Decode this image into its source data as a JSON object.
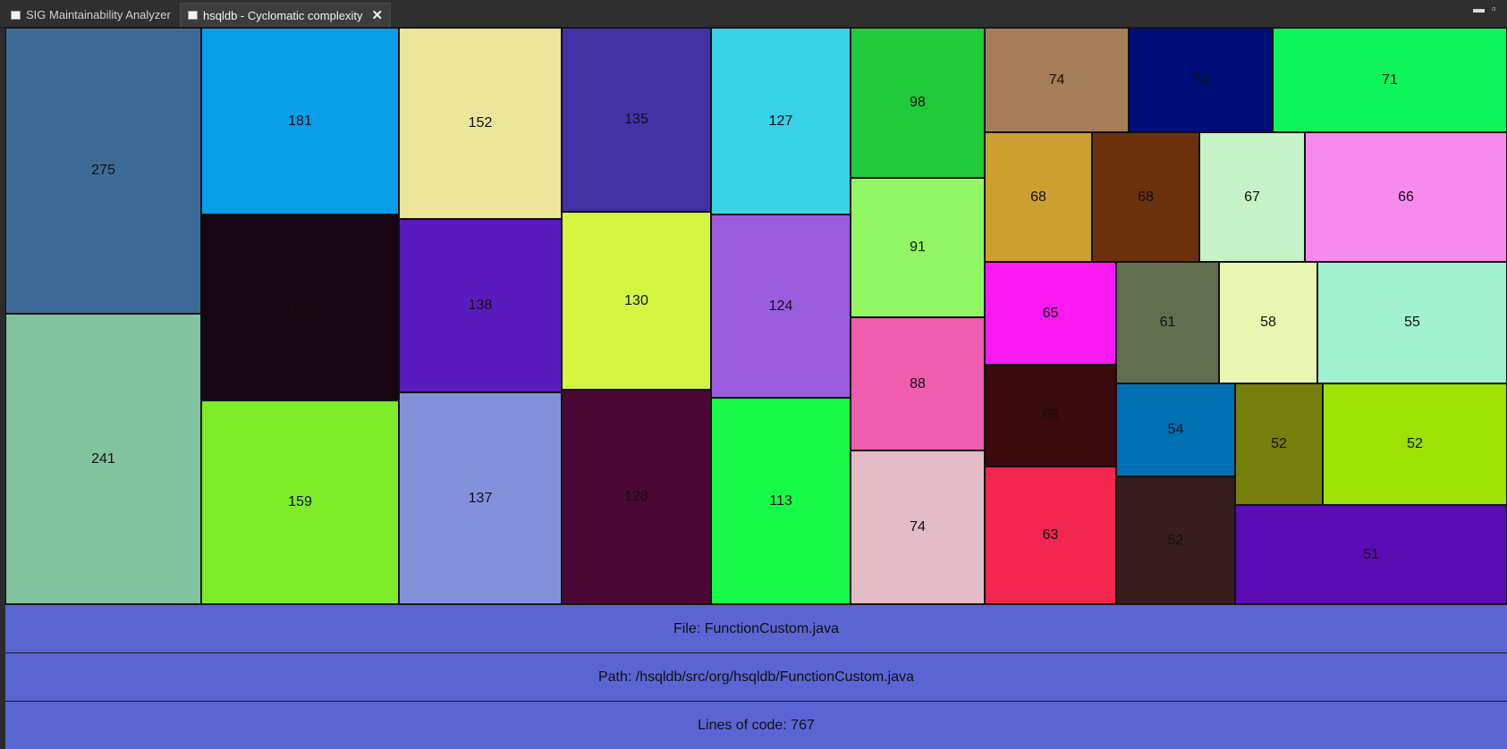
{
  "tabs": [
    {
      "label": "SIG Maintainability Analyzer",
      "active": false
    },
    {
      "label": "hsqldb - Cyclomatic complexity",
      "active": true
    }
  ],
  "window_controls": {
    "minimize": "▬",
    "restore": "▫"
  },
  "treemap": {
    "values": [
      275,
      241,
      181,
      179,
      159,
      152,
      138,
      137,
      135,
      130,
      128,
      127,
      124,
      113,
      98,
      91,
      88,
      74,
      74,
      74,
      71,
      68,
      68,
      67,
      66,
      65,
      65,
      63,
      61,
      58,
      55,
      54,
      52,
      52,
      52,
      51
    ],
    "colors": [
      "#3c6b98",
      "#82c3a0",
      "#089ee8",
      "#180612",
      "#7eec28",
      "#ece59a",
      "#5b1ac0",
      "#8391dc",
      "#4132a6",
      "#d5f541",
      "#4a0733",
      "#37d2e6",
      "#9c5cde",
      "#16fa48",
      "#1fcb38",
      "#92f765",
      "#ef5dae",
      "#e4bcc8",
      "#a57e57",
      "#000c78",
      "#0ef45b",
      "#cb9f30",
      "#6b310c",
      "#c6f2c8",
      "#f78aec",
      "#fb19f3",
      "#3a0a0c",
      "#f2264f",
      "#616f4f",
      "#e9f7b2",
      "#a2f2d0",
      "#0070b5",
      "#767f0a",
      "#9de105",
      "#381c1e",
      "#5b0cb4"
    ]
  },
  "info": {
    "file": "File: FunctionCustom.java",
    "path": "Path: /hsqldb/src/org/hsqldb/FunctionCustom.java",
    "loc": "Lines of code: 767"
  }
}
